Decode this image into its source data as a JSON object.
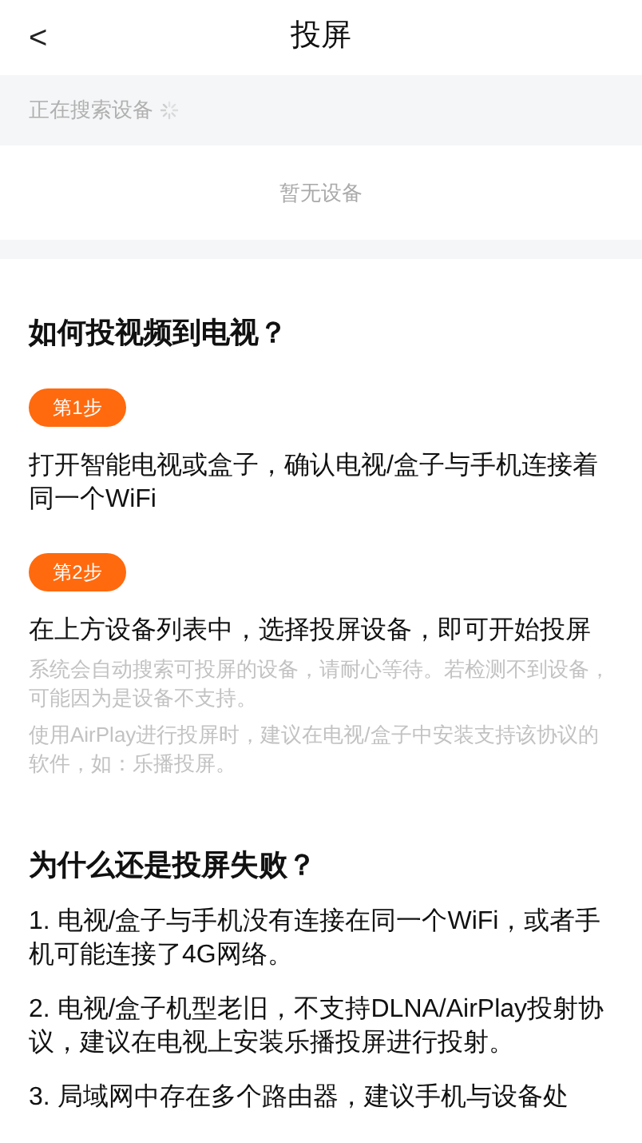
{
  "header": {
    "back": "<",
    "title": "投屏"
  },
  "search_status": {
    "label": "正在搜索设备",
    "searching": true
  },
  "empty_message": "暂无设备",
  "guide": {
    "title": "如何投视频到电视？",
    "steps": [
      {
        "badge": "第1步",
        "text": "打开智能电视或盒子，确认电视/盒子与手机连接着同一个WiFi"
      },
      {
        "badge": "第2步",
        "text": "在上方设备列表中，选择投屏设备，即可开始投屏",
        "notes": [
          "系统会自动搜索可投屏的设备，请耐心等待。若检测不到设备，可能因为是设备不支持。",
          "使用AirPlay进行投屏时，建议在电视/盒子中安装支持该协议的软件，如：乐播投屏。"
        ]
      }
    ]
  },
  "troubleshoot": {
    "title": "为什么还是投屏失败？",
    "items": [
      "1. 电视/盒子与手机没有连接在同一个WiFi，或者手机可能连接了4G网络。",
      "2. 电视/盒子机型老旧，不支持DLNA/AirPlay投射协议，建议在电视上安装乐播投屏进行投射。",
      "3. 局域网中存在多个路由器，建议手机与设备处"
    ]
  }
}
